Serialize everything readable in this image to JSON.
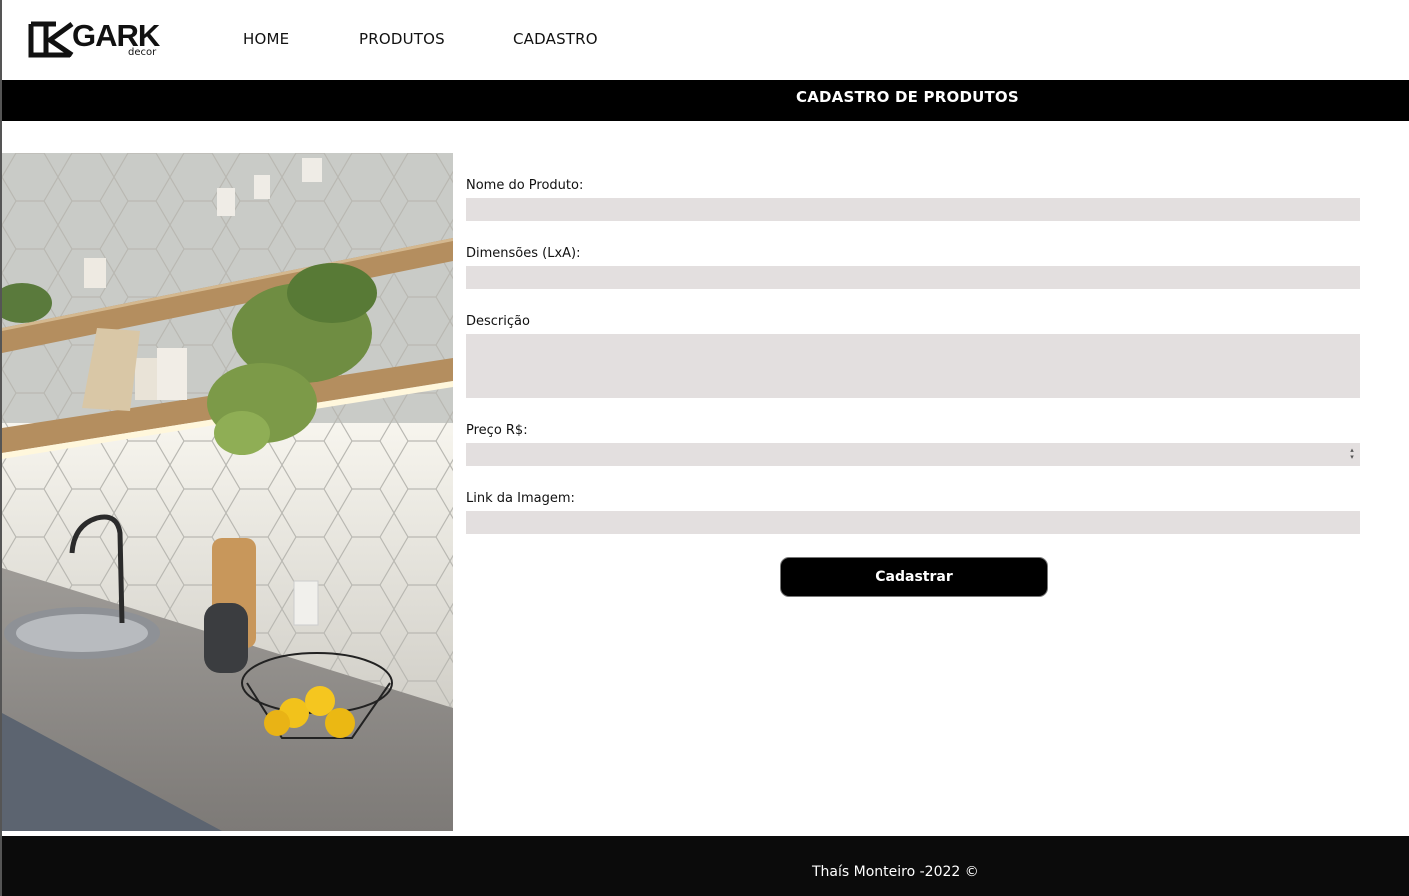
{
  "brand": {
    "logo_main": "GARK",
    "logo_sub": "decor"
  },
  "nav": {
    "items": [
      {
        "label": "HOME"
      },
      {
        "label": "PRODUTOS"
      },
      {
        "label": "CADASTRO"
      }
    ]
  },
  "page_title": "CADASTRO DE PRODUTOS",
  "hero_image": {
    "alt": "kitchen-photo"
  },
  "form": {
    "fields": [
      {
        "label": "Nome do Produto:",
        "value": "",
        "placeholder": ""
      },
      {
        "label": "Dimensões (LxA):",
        "value": "",
        "placeholder": ""
      },
      {
        "label": "Descrição",
        "value": "",
        "placeholder": ""
      },
      {
        "label": "Preço R$:",
        "value": "",
        "placeholder": ""
      },
      {
        "label": "Link da Imagem:",
        "value": "",
        "placeholder": ""
      }
    ],
    "submit_label": "Cadastrar"
  },
  "footer": {
    "text": "Thaís Monteiro -2022 ©"
  },
  "colors": {
    "accent": "#000000",
    "input_bg": "#e3dfdf",
    "footer_bg": "#0b0b0b"
  }
}
